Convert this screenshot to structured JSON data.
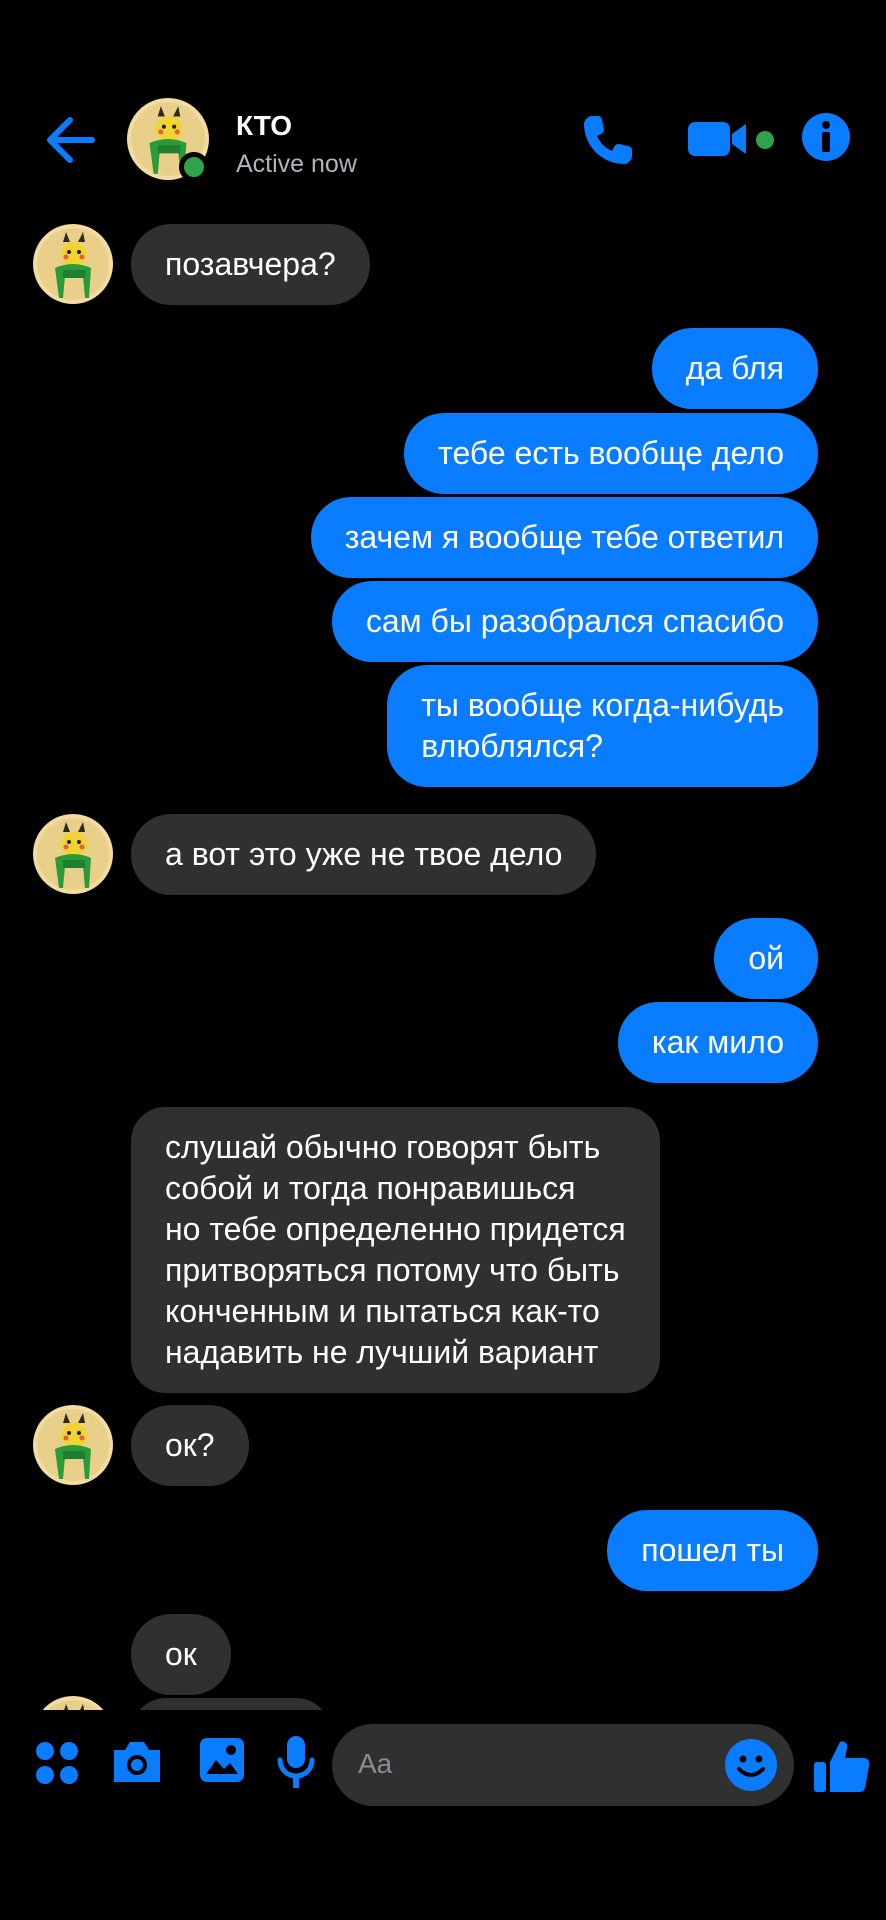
{
  "header": {
    "contact_name": "КТО",
    "status": "Active now"
  },
  "messages": [
    {
      "side": "in",
      "text": "позавчера?"
    },
    {
      "side": "out",
      "text": "да бля"
    },
    {
      "side": "out",
      "text": "тебе есть вообще дело"
    },
    {
      "side": "out",
      "text": "зачем я вообще тебе ответил"
    },
    {
      "side": "out",
      "text": "сам бы разобрался спасибо"
    },
    {
      "side": "out",
      "text": "ты вообще когда-нибудь\nвлюблялся?"
    },
    {
      "side": "in",
      "text": "а вот это уже не твое дело"
    },
    {
      "side": "out",
      "text": "ой"
    },
    {
      "side": "out",
      "text": "как мило"
    },
    {
      "side": "in",
      "text": "слушай обычно говорят быть\nсобой и тогда понравишься\nно тебе определенно придется\nпритворяться потому что быть\nконченным и пытаться как-то\nнадавить не лучший вариант"
    },
    {
      "side": "in",
      "text": "ок?"
    },
    {
      "side": "out",
      "text": "пошел ты"
    },
    {
      "side": "in",
      "text": "ок"
    }
  ],
  "composer": {
    "placeholder": "Aa"
  },
  "colors": {
    "accent": "#0a7cff",
    "incoming_bubble": "#303030",
    "online": "#31a24c"
  },
  "icons": [
    "back-arrow-icon",
    "phone-icon",
    "video-camera-icon",
    "info-icon",
    "apps-grid-icon",
    "camera-icon",
    "gallery-icon",
    "microphone-icon",
    "emoji-icon",
    "thumbs-up-icon"
  ]
}
